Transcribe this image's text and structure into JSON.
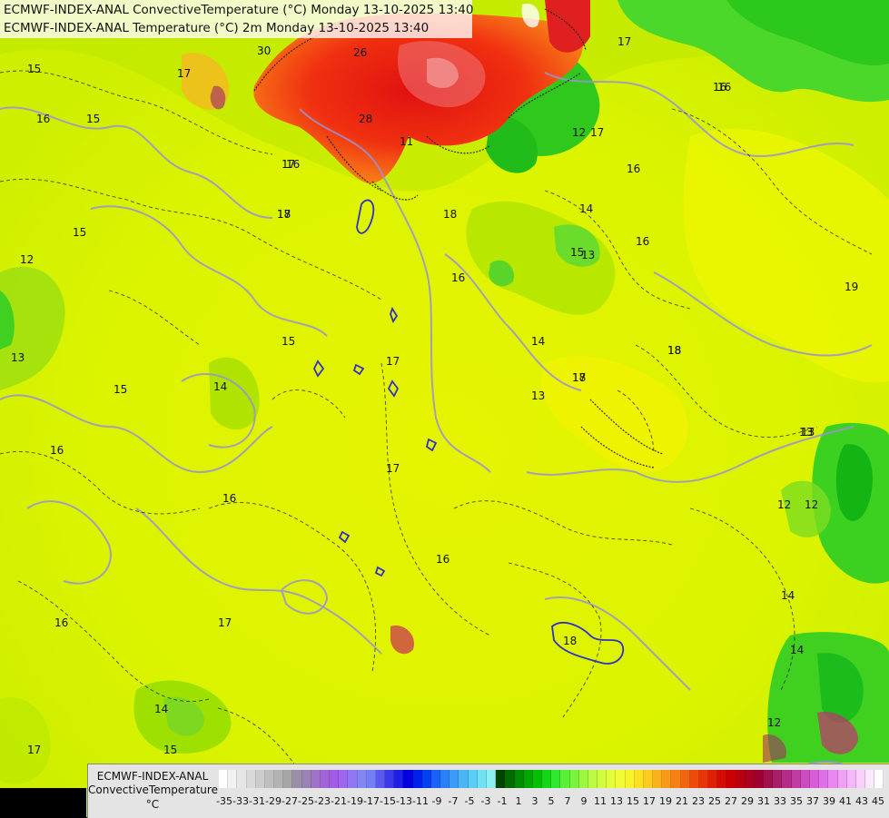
{
  "titles": {
    "line1": "ECMWF-INDEX-ANAL ConvectiveTemperature (°C) Monday 13-10-2025 13:40",
    "line2": "ECMWF-INDEX-ANAL Temperature (°C) 2m Monday 13-10-2025 13:40"
  },
  "colorbar": {
    "model": "ECMWF-INDEX-ANAL",
    "variable": "ConvectiveTemperature",
    "unit": "°C",
    "tick_labels": [
      "-35",
      "-33",
      "-31",
      "-29",
      "-27",
      "-25",
      "-23",
      "-21",
      "-19",
      "-17",
      "-15",
      "-13",
      "-11",
      "-9",
      "-7",
      "-5",
      "-3",
      "-1",
      "1",
      "3",
      "5",
      "7",
      "9",
      "11",
      "13",
      "15",
      "17",
      "19",
      "21",
      "23",
      "25",
      "27",
      "29",
      "31",
      "33",
      "35",
      "37",
      "39",
      "41",
      "43",
      "45"
    ],
    "colors": [
      "#ffffff",
      "#f2f2f2",
      "#e6e6e6",
      "#d9d9d9",
      "#cccccc",
      "#bfbfbf",
      "#b3b3b3",
      "#a6a6a6",
      "#9a8fa8",
      "#9b82b6",
      "#9f73c8",
      "#a064d8",
      "#a35ae6",
      "#9d66ee",
      "#8f78f2",
      "#8188f4",
      "#737ff4",
      "#5a5af0",
      "#3a3aec",
      "#1f1fe6",
      "#0000e0",
      "#0020ec",
      "#0040f4",
      "#1a62f6",
      "#2a80f8",
      "#3a9cf8",
      "#4ab6f6",
      "#5ccdf4",
      "#70e0f2",
      "#8cf0f0",
      "#004400",
      "#006a00",
      "#008c00",
      "#00a800",
      "#00c200",
      "#14d614",
      "#30e630",
      "#5af038",
      "#78f43c",
      "#9cf83e",
      "#bafa40",
      "#d2fc40",
      "#e4fe3c",
      "#f2fc34",
      "#faf22a",
      "#fce024",
      "#fcca20",
      "#fab21c",
      "#f89a18",
      "#f68014",
      "#f26410",
      "#ee4a0c",
      "#e83408",
      "#e02006",
      "#d40c04",
      "#c80004",
      "#b80010",
      "#a8001e",
      "#9e0032",
      "#a0104c",
      "#a81e68",
      "#b42c86",
      "#c03ca4",
      "#cc4cc0",
      "#d85cd8",
      "#e070e8",
      "#e888f0",
      "#f0a0f4",
      "#f4b8f8",
      "#f8d0fa",
      "#fce8fc",
      "#ffffff"
    ]
  },
  "contour_labels": [
    "15",
    "16",
    "15",
    "17",
    "16",
    "17",
    "18",
    "16",
    "14",
    "15",
    "16",
    "16",
    "12",
    "13",
    "15",
    "17",
    "16",
    "16",
    "17",
    "17",
    "16",
    "14",
    "15",
    "18",
    "17",
    "16",
    "17",
    "14",
    "15",
    "12",
    "14",
    "13",
    "18",
    "19",
    "12",
    "14",
    "13",
    "30",
    "26",
    "28",
    "16",
    "15",
    "17",
    "17",
    "18",
    "18",
    "13",
    "18",
    "12",
    "14",
    "11",
    "12",
    "13",
    "17",
    "16"
  ]
}
